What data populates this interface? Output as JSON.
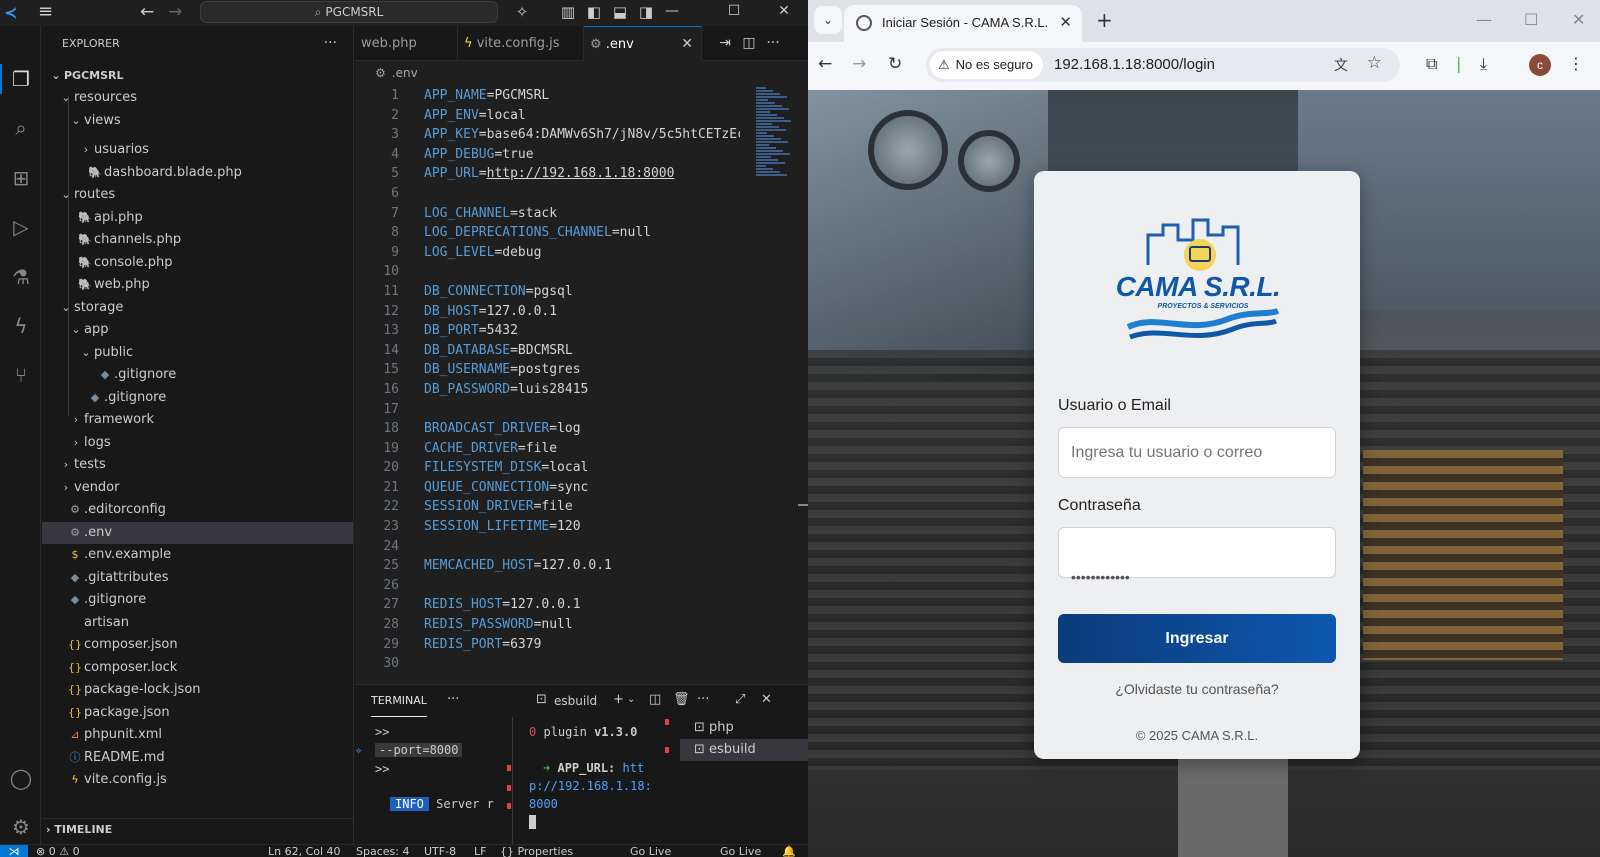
{
  "vscode": {
    "search_text": "PGCMSRL",
    "explorer_title": "EXPLORER",
    "timeline_title": "TIMELINE",
    "tree": [
      {
        "label": "PGCMSRL",
        "chev": "⌄"
      },
      {
        "label": "resources",
        "chev": "⌄"
      },
      {
        "label": "views",
        "chev": "⌄"
      },
      {
        "label": "usuarios",
        "chev": "›"
      },
      {
        "label": "dashboard.blade.php",
        "chev": ""
      },
      {
        "label": "routes",
        "chev": "⌄"
      },
      {
        "label": "api.php",
        "chev": ""
      },
      {
        "label": "channels.php",
        "chev": ""
      },
      {
        "label": "console.php",
        "chev": ""
      },
      {
        "label": "web.php",
        "chev": ""
      },
      {
        "label": "storage",
        "chev": "⌄"
      },
      {
        "label": "app",
        "chev": "⌄"
      },
      {
        "label": "public",
        "chev": "⌄"
      },
      {
        "label": ".gitignore",
        "chev": ""
      },
      {
        "label": ".gitignore",
        "chev": ""
      },
      {
        "label": "framework",
        "chev": "›"
      },
      {
        "label": "logs",
        "chev": "›"
      },
      {
        "label": "tests",
        "chev": "›"
      },
      {
        "label": "vendor",
        "chev": "›"
      },
      {
        "label": ".editorconfig",
        "chev": ""
      },
      {
        "label": ".env",
        "chev": ""
      },
      {
        "label": ".env.example",
        "chev": ""
      },
      {
        "label": ".gitattributes",
        "chev": ""
      },
      {
        "label": ".gitignore",
        "chev": ""
      },
      {
        "label": "artisan",
        "chev": ""
      },
      {
        "label": "composer.json",
        "chev": ""
      },
      {
        "label": "composer.lock",
        "chev": ""
      },
      {
        "label": "package-lock.json",
        "chev": ""
      },
      {
        "label": "package.json",
        "chev": ""
      },
      {
        "label": "phpunit.xml",
        "chev": ""
      },
      {
        "label": "README.md",
        "chev": ""
      },
      {
        "label": "vite.config.js",
        "chev": ""
      }
    ],
    "tabs": [
      {
        "label": "web.php"
      },
      {
        "label": "vite.config.js"
      },
      {
        "label": ".env"
      }
    ],
    "breadcrumb": ".env",
    "code_lines": [
      {
        "n": "1",
        "k": "APP_NAME",
        "v": "PGCMSRL"
      },
      {
        "n": "2",
        "k": "APP_ENV",
        "v": "local"
      },
      {
        "n": "3",
        "k": "APP_KEY",
        "v": "base64:DAMWv6Sh7/jN8v/5c5htCETzEc"
      },
      {
        "n": "4",
        "k": "APP_DEBUG",
        "v": "true"
      },
      {
        "n": "5",
        "k": "APP_URL",
        "v": "http://192.168.1.18:8000"
      },
      {
        "n": "6",
        "k": "",
        "v": ""
      },
      {
        "n": "7",
        "k": "LOG_CHANNEL",
        "v": "stack"
      },
      {
        "n": "8",
        "k": "LOG_DEPRECATIONS_CHANNEL",
        "v": "null"
      },
      {
        "n": "9",
        "k": "LOG_LEVEL",
        "v": "debug"
      },
      {
        "n": "10",
        "k": "",
        "v": ""
      },
      {
        "n": "11",
        "k": "DB_CONNECTION",
        "v": "pgsql"
      },
      {
        "n": "12",
        "k": "DB_HOST",
        "v": "127.0.0.1"
      },
      {
        "n": "13",
        "k": "DB_PORT",
        "v": "5432"
      },
      {
        "n": "14",
        "k": "DB_DATABASE",
        "v": "BDCMSRL"
      },
      {
        "n": "15",
        "k": "DB_USERNAME",
        "v": "postgres"
      },
      {
        "n": "16",
        "k": "DB_PASSWORD",
        "v": "luis28415"
      },
      {
        "n": "17",
        "k": "",
        "v": ""
      },
      {
        "n": "18",
        "k": "BROADCAST_DRIVER",
        "v": "log"
      },
      {
        "n": "19",
        "k": "CACHE_DRIVER",
        "v": "file"
      },
      {
        "n": "20",
        "k": "FILESYSTEM_DISK",
        "v": "local"
      },
      {
        "n": "21",
        "k": "QUEUE_CONNECTION",
        "v": "sync"
      },
      {
        "n": "22",
        "k": "SESSION_DRIVER",
        "v": "file"
      },
      {
        "n": "23",
        "k": "SESSION_LIFETIME",
        "v": "120"
      },
      {
        "n": "24",
        "k": "",
        "v": ""
      },
      {
        "n": "25",
        "k": "MEMCACHED_HOST",
        "v": "127.0.0.1"
      },
      {
        "n": "26",
        "k": "",
        "v": ""
      },
      {
        "n": "27",
        "k": "REDIS_HOST",
        "v": "127.0.0.1"
      },
      {
        "n": "28",
        "k": "REDIS_PASSWORD",
        "v": "null"
      },
      {
        "n": "29",
        "k": "REDIS_PORT",
        "v": "6379"
      },
      {
        "n": "30",
        "k": "",
        "v": ""
      }
    ],
    "panel": {
      "tab": "TERMINAL",
      "shell_label": "esbuild",
      "term_left": {
        "prompt1": ">>",
        "port": "--port=8000",
        "prompt2": ">>",
        "info_badge": "INFO",
        "info_text": "Server r"
      },
      "term_mid": {
        "zero": "0",
        "plugin": "plugin",
        "version": "v1.3.0",
        "arrow": "➜",
        "app_url_label": "APP_URL:",
        "app_url_a": "htt",
        "app_url_b": "p://192.168.1.18:",
        "app_url_c": "8000"
      },
      "terminals": [
        {
          "label": "php"
        },
        {
          "label": "esbuild"
        }
      ]
    },
    "status": {
      "problems": "⊗ 0 ⚠ 0",
      "position": "Ln 62, Col 40",
      "spaces": "Spaces: 4",
      "encoding": "UTF-8",
      "eol": "LF",
      "language": "{} Properties",
      "golive1": "Go Live",
      "golive2": "Go Live"
    }
  },
  "browser": {
    "tab_title": "Iniciar Sesión - CAMA S.R.L.",
    "security_chip": "No es seguro",
    "url": "192.168.1.18:8000/login",
    "avatar_letter": "c",
    "login": {
      "logo_name": "CAMA S.R.L.",
      "logo_tagline": "PROYECTOS & SERVICIOS",
      "user_label": "Usuario o Email",
      "user_placeholder": "Ingresa tu usuario o correo",
      "password_label": "Contraseña",
      "password_value": "••••••••••••",
      "submit": "Ingresar",
      "forgot": "¿Olvidaste tu contraseña?",
      "copyright": "© 2025 CAMA S.R.L."
    }
  }
}
